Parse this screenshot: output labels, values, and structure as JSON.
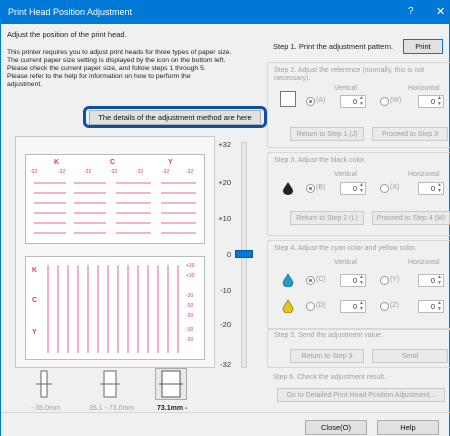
{
  "window": {
    "title": "Print Head Position Adjustment",
    "help_glyph": "?",
    "close_glyph": "✕"
  },
  "intro": {
    "heading": "Adjust the position of the print head.",
    "lines": [
      "This printer requires you to adjust print heads for three types of paper size.",
      "The current paper size setting is displayed by the icon on the bottom left.",
      "Please check the current paper size, and follow steps 1 through 5.",
      "Please refer to the help for information on how to perform the",
      "adjustment."
    ],
    "details_button": "The details of the adjustment method are here"
  },
  "pattern": {
    "top_letters": [
      "K",
      "C",
      "Y"
    ],
    "top_numbers": [
      "-32",
      "-32",
      "-32",
      "-32",
      "-32",
      "-32",
      "-32"
    ],
    "side_letters": [
      "K",
      "C",
      "Y"
    ],
    "side_numbers": [
      "+30",
      "+30",
      "-30",
      "-30",
      "-30",
      "-30",
      "-30"
    ]
  },
  "slider": {
    "ticks": [
      "+32",
      "+20",
      "+10",
      "0",
      "-10",
      "-20",
      "-32"
    ],
    "value": 0
  },
  "paper_sizes": [
    {
      "label": "- 35.0mm",
      "icon": "paper-narrow-icon",
      "selected": false
    },
    {
      "label": "35.1 - 73.0mm",
      "icon": "paper-medium-icon",
      "selected": false
    },
    {
      "label": "73.1mm -",
      "icon": "paper-wide-icon",
      "selected": true
    }
  ],
  "step1": {
    "label": "Step 1. Print the adjustment pattern.",
    "print_button": "Print"
  },
  "step2": {
    "label": "Step 2. Adjust the reference (normally, this is not necessary).",
    "vertical": "Vertical",
    "horizontal": "Horizontal",
    "radio_a": "(A)",
    "radio_w": "(W)",
    "value_a": "0",
    "value_w": "0",
    "return_button": "Return to Step 1 (J)",
    "proceed_button": "Proceed to Step 3"
  },
  "step3": {
    "label": "Step 3. Adjust the black color.",
    "vertical": "Vertical",
    "horizontal": "Horizontal",
    "radio_b": "(B)",
    "radio_x": "(X)",
    "value_b": "0",
    "value_x": "0",
    "return_button": "Return to Step 2 (L)",
    "proceed_button": "Proceed to Step 4 (M)"
  },
  "step4": {
    "label": "Step 4. Adjust the cyan color and yellow color.",
    "vertical": "Vertical",
    "horizontal": "Horizontal",
    "radio_c": "(C)",
    "radio_y": "(Y)",
    "radio_d": "(D)",
    "radio_z": "(Z)",
    "value_c": "0",
    "value_y": "0",
    "value_d": "0",
    "value_z": "0"
  },
  "step5": {
    "label": "Step 5. Send the adjustment value.",
    "return_button": "Return to Step 3",
    "send_button": "Send"
  },
  "step6": {
    "label": "Step 6. Check the adjustment result.",
    "goto_button": "Go to Detailed Print Head Position Adjustment..."
  },
  "footer": {
    "close_button": "Close(O)",
    "help_button": "Help"
  },
  "colors": {
    "accent": "#0078d7",
    "pattern": "#e0347a",
    "highlight": "#0b4fa8"
  }
}
